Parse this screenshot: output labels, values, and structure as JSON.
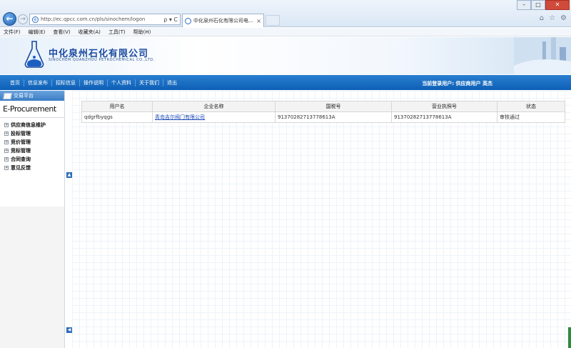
{
  "browser": {
    "url": "http://ec.qpcc.com.cn/pls/sinochem/logon",
    "tab_title": "中化泉州石化有限公司电...",
    "search_tools": "ρ ▾ C"
  },
  "menubar": [
    "文件(F)",
    "编辑(E)",
    "查看(V)",
    "收藏夹(A)",
    "工具(T)",
    "帮助(H)"
  ],
  "site": {
    "name_cn": "中化泉州石化有限公司",
    "name_en": "SINOCHEM QUANZHOU PETROCHEMICAL CO.,LTD."
  },
  "nav": {
    "items": [
      "首页",
      "信息发布",
      "招标信息",
      "操作说明",
      "个人资料",
      "关于我们",
      "退出"
    ],
    "user_info": "当前登录用户: 供应商用户 英杰"
  },
  "sidebar": {
    "header": "交易平台",
    "logo_text": "E-Procurement",
    "items": [
      "供应商信息维护",
      "投标管理",
      "竞价管理",
      "竞标管理",
      "合同查询",
      "意见反馈"
    ]
  },
  "table": {
    "headers": [
      "用户名",
      "企业名称",
      "国税号",
      "营业执照号",
      "状态"
    ],
    "rows": [
      [
        "qdgrfbyqgs",
        "青岛吉尔阀门有限公司",
        "91370282713778613A",
        "91370282713778613A",
        "审核通过"
      ]
    ]
  },
  "colors": {
    "nav_blue": "#0d5fb5",
    "brand_blue": "#1a4aa0",
    "link_blue": "#1a47b8"
  }
}
